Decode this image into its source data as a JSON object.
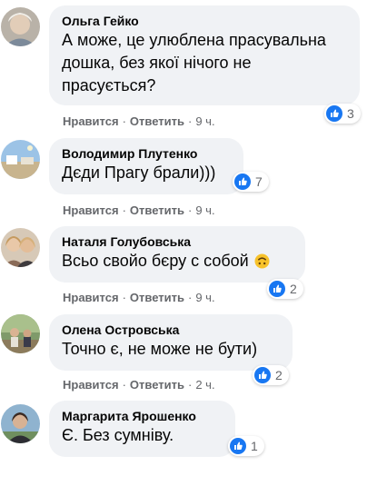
{
  "comments": [
    {
      "author": "Ольга Гейко",
      "lines": [
        "А може, це улюблена прасувальна",
        "дошка, без якої нічого не",
        "прасується?"
      ],
      "reactions": "3",
      "like": "Нравится",
      "reply": "Ответить",
      "time": "9 ч."
    },
    {
      "author": "Володимир Плутенко",
      "lines": [
        "Дєди Прагу брали)))"
      ],
      "reactions": "7",
      "like": "Нравится",
      "reply": "Ответить",
      "time": "9 ч."
    },
    {
      "author": "Наталя Голубовська",
      "lines": [
        "Всьо свойо бєру с собой"
      ],
      "emoji": "upside-down-face-icon",
      "reactions": "2",
      "like": "Нравится",
      "reply": "Ответить",
      "time": "9 ч."
    },
    {
      "author": "Олена Островська",
      "lines": [
        "Точно є, не може не бути)"
      ],
      "reactions": "2",
      "like": "Нравится",
      "reply": "Ответить",
      "time": "2 ч."
    },
    {
      "author": "Маргарита Ярошенко",
      "lines": [
        "Є. Без сумніву."
      ],
      "reactions": "1"
    }
  ],
  "separator": "·",
  "colors": {
    "bubble": "#f0f2f5",
    "like_blue": "#1877f2",
    "meta_text": "#65676b"
  },
  "icons": {
    "reaction": "like-thumbs-up-icon"
  }
}
